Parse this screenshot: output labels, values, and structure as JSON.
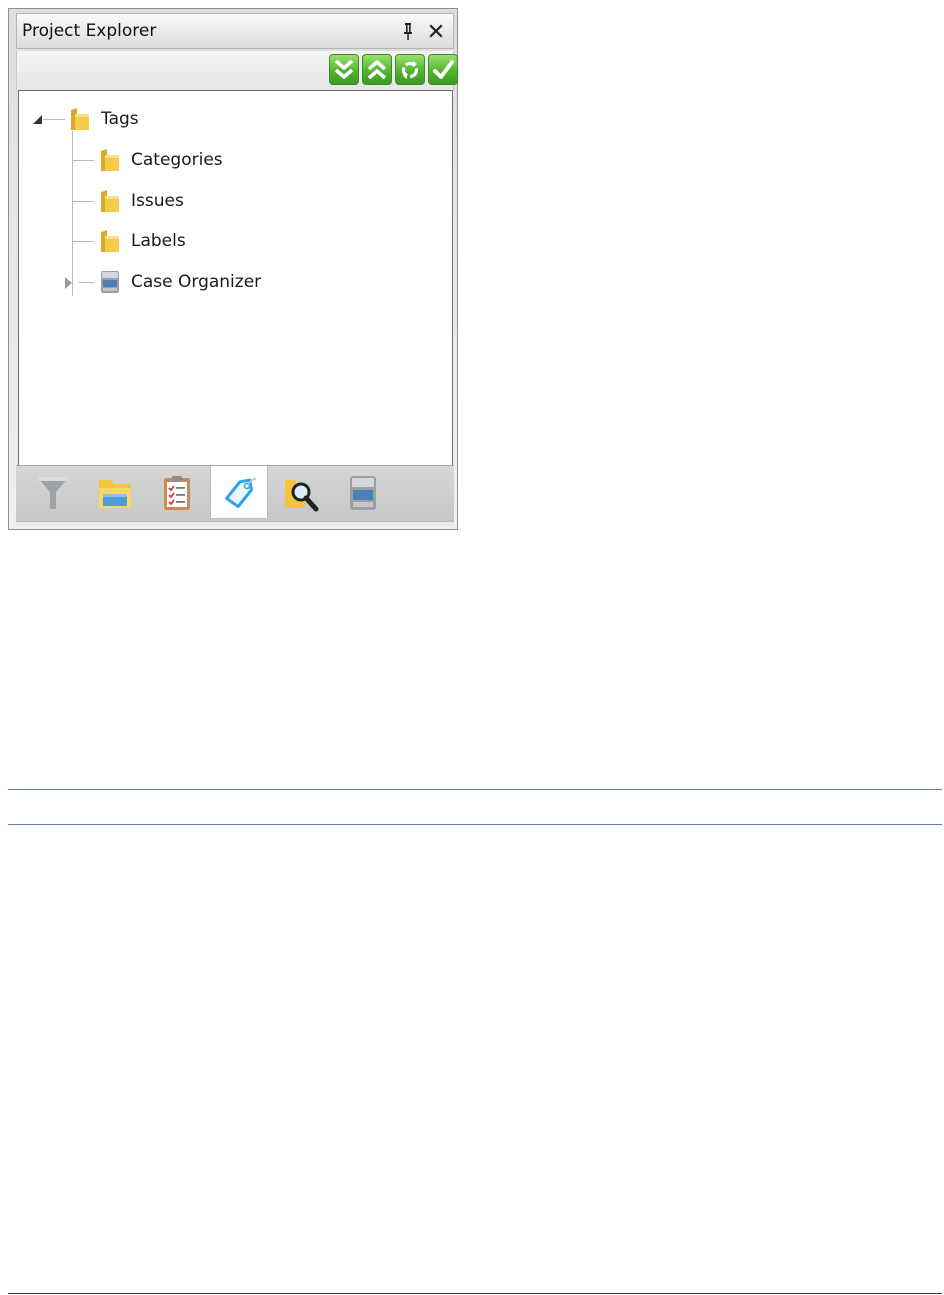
{
  "panel": {
    "title": "Project Explorer"
  },
  "toolbar": {
    "buttons": [
      {
        "icon": "expand-all-icon"
      },
      {
        "icon": "collapse-all-icon"
      },
      {
        "icon": "refresh-icon"
      },
      {
        "icon": "apply-check-icon"
      }
    ]
  },
  "tree": {
    "root": {
      "label": "Tags",
      "expanded": true,
      "icon": "folder-icon"
    },
    "children": [
      {
        "label": "Categories",
        "icon": "folder-icon"
      },
      {
        "label": "Issues",
        "icon": "folder-icon"
      },
      {
        "label": "Labels",
        "icon": "folder-icon"
      },
      {
        "label": "Case Organizer",
        "icon": "cabinet-icon",
        "expandable": true
      }
    ]
  },
  "tabs": [
    {
      "icon": "filter-funnel-icon",
      "active": false
    },
    {
      "icon": "folder-window-icon",
      "active": false
    },
    {
      "icon": "clipboard-checklist-icon",
      "active": false
    },
    {
      "icon": "tag-icon",
      "active": true
    },
    {
      "icon": "search-magnifier-icon",
      "active": false
    },
    {
      "icon": "cabinet-icon",
      "active": false
    }
  ],
  "colors": {
    "accent_green": "#53b52f",
    "folder_yellow": "#f2c53d",
    "tag_blue": "#2ea2e6",
    "divider_blue": "#5f7fa8"
  }
}
